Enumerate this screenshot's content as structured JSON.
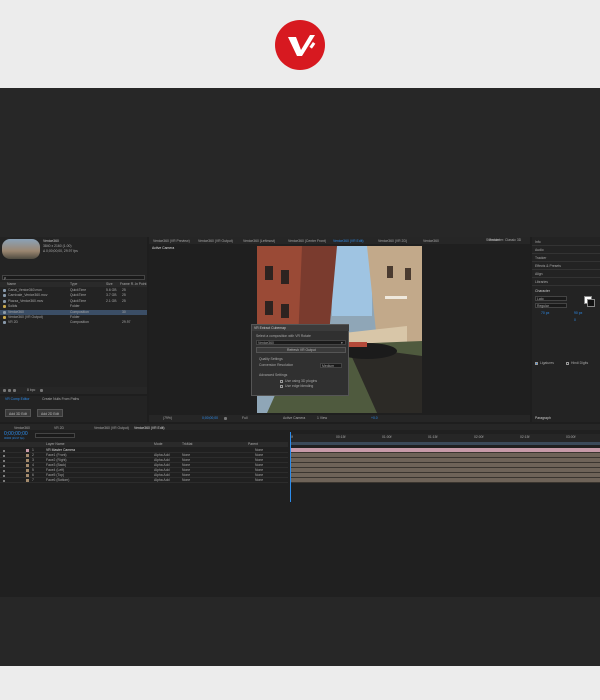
{
  "app": {
    "comp_name": "Venice360",
    "comp_info": "3840 x 2160 (1.00)",
    "comp_duration": "Δ 0;00;00;00, 29.97 fps"
  },
  "project": {
    "search_placeholder": "ρ",
    "columns": [
      "Name",
      "Type",
      "Size",
      "Frame R...",
      "In Point"
    ],
    "items": [
      {
        "name": "Canal_Venice360.mov",
        "type": "QuickTime",
        "size": "5.6 GB",
        "fps": "25"
      },
      {
        "name": "Carnivale_Venice360.mov",
        "type": "QuickTime",
        "size": "3.7 GB",
        "fps": "25"
      },
      {
        "name": "Piazza_Venice360.mov",
        "type": "QuickTime",
        "size": "2.1 GB",
        "fps": "25"
      },
      {
        "name": "Solids",
        "type": "Folder",
        "size": "",
        "fps": ""
      },
      {
        "name": "Venice360",
        "type": "Composition",
        "size": "",
        "fps": "30"
      },
      {
        "name": "Venice360 (VR Output)",
        "type": "Folder",
        "size": "",
        "fps": ""
      },
      {
        "name": "VR 2D",
        "type": "Composition",
        "size": "",
        "fps": "29.97"
      }
    ],
    "footer_bpc": "8 bpc"
  },
  "vr_panel": {
    "tabs": [
      "VR Comp Editor",
      "Create Nulls From Paths"
    ],
    "buttons": [
      "Add 3D Edit",
      "Add 2D Edit"
    ]
  },
  "viewer": {
    "tabs": [
      "Venice360 (VR Preview)",
      "Venice360 (VR Output)",
      "Venice360 (Leftmost)",
      "Venice360 (Center Front)",
      "Venice360 (VR Edit)",
      "Venice360 (VR 2D)",
      "Venice360"
    ],
    "label": "Active Camera",
    "renderer": "Renderer: Classic 3D",
    "zoom": "(79%)",
    "timecode": "0;00;00;00",
    "resolution": "Full",
    "camera": "Active Camera",
    "views": "1 View",
    "exposure": "+0.0"
  },
  "dialog": {
    "title": "VR Extract Cubemap",
    "subtitle": "Select a composition with VR Rotate",
    "comp_value": "Venice360",
    "refresh_label": "Refresh VR Output",
    "quality_heading": "Quality Settings",
    "res_label": "Conversion Resolution",
    "res_value": "Medium",
    "adv_heading": "Advanced Settings",
    "opt1": "Use using 3D plugins",
    "opt2": "Use edge blending"
  },
  "right_panel": {
    "workspace": "Standard",
    "items": [
      "Info",
      "Audio",
      "Tracker",
      "Effects & Presets",
      "Align",
      "Libraries"
    ],
    "character_title": "Character",
    "font": "Lato",
    "style": "Regular",
    "size": "70 px",
    "leading": "90 px",
    "tracking": "0",
    "opt_ligatures": "Ligatures",
    "opt_hindi": "Hindi Digits",
    "paragraph_title": "Paragraph"
  },
  "timeline": {
    "comp_tabs": [
      "Venice360",
      "VR 2D",
      "Venice360 (VR Output)",
      "Venice360 (VR Edit)"
    ],
    "timecode": "0;00;00;00",
    "timecode_sub": "00000 (29.97 fps)",
    "columns": {
      "layer_name": "Layer Name",
      "mode": "Mode",
      "trkmat": "TrkMat",
      "parent": "Parent"
    },
    "layers": [
      {
        "num": "1",
        "name": "VR Master Camera",
        "mode": "",
        "trk": "",
        "parent": "None"
      },
      {
        "num": "2",
        "name": "Face1 (Front)",
        "mode": "Alpha Add",
        "trk": "None",
        "parent": "None"
      },
      {
        "num": "3",
        "name": "Face2 (Right)",
        "mode": "Alpha Add",
        "trk": "None",
        "parent": "None"
      },
      {
        "num": "4",
        "name": "Face3 (Back)",
        "mode": "Alpha Add",
        "trk": "None",
        "parent": "None"
      },
      {
        "num": "5",
        "name": "Face4 (Left)",
        "mode": "Alpha Add",
        "trk": "None",
        "parent": "None"
      },
      {
        "num": "6",
        "name": "Face5 (Top)",
        "mode": "Alpha Add",
        "trk": "None",
        "parent": "None"
      },
      {
        "num": "7",
        "name": "Face6 (Bottom)",
        "mode": "Alpha Add",
        "trk": "None",
        "parent": "None"
      }
    ],
    "ruler": [
      "0f",
      "00:15f",
      "01:00f",
      "01:15f",
      "02:00f",
      "02:15f",
      "03:00f"
    ]
  },
  "colors": {
    "accent": "#2d8ceb",
    "logo": "#d71920",
    "track": "#6e6358",
    "camera_track": "#c79aa8"
  }
}
